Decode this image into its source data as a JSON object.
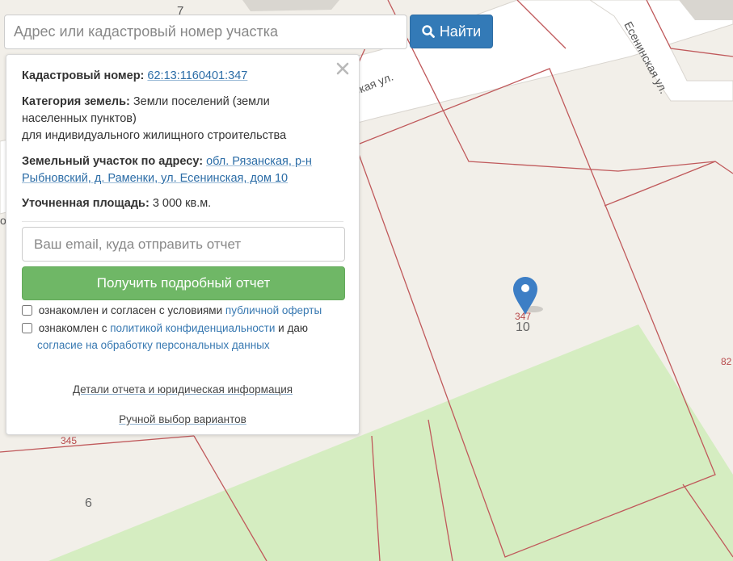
{
  "map": {
    "street_1": "ская ул.",
    "street_2": "Есенинская ул.",
    "parcel_numbers": {
      "n7": "7",
      "n347": "347",
      "n10": "10",
      "n82": "82",
      "n345": "345",
      "n6": "6",
      "edge_glyph": "о"
    },
    "colors": {
      "background": "#f2efe9",
      "road": "#ffffff",
      "boundary": "#c0595b",
      "field": "#d5edc1",
      "marker": "#3d7ec5"
    }
  },
  "search": {
    "placeholder": "Адрес или кадастровый номер участка",
    "button_label": "Найти",
    "button_icon": "search-icon"
  },
  "panel": {
    "close_icon": "close-icon",
    "cadastral_label": "Кадастровый номер:",
    "cadastral_value": "62:13:1160401:347",
    "category_label": "Категория земель:",
    "category_value_1": "Земли поселений (земли",
    "category_value_2": "населенных пунктов)",
    "category_value_3": "для индивидуального жилищного строительства",
    "address_label": "Земельный участок по адресу:",
    "address_value_1": "обл. Рязанская, р-н",
    "address_value_2": "Рыбновский, д. Раменки, ул. Есенинская, дом 10",
    "area_label": "Уточненная площадь:",
    "area_value": "3 000 кв.м.",
    "email_placeholder": "Ваш email, куда отправить отчет",
    "report_button": "Получить подробный отчет",
    "consent_1_text": "ознакомлен и согласен с условиями",
    "consent_1_link": "публичной оферты",
    "consent_2_text_a": "ознакомлен с",
    "consent_2_link_a": "политикой конфиденциальности",
    "consent_2_text_b": "и даю",
    "consent_2_link_b": "согласие на обработку персональных данных",
    "details_link": "Детали отчета и юридическая информация",
    "manual_link": "Ручной выбор вариантов"
  }
}
